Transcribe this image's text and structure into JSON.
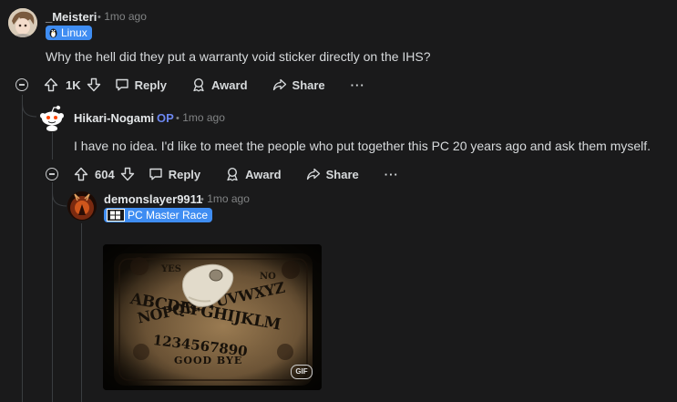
{
  "comments": [
    {
      "username": "_Meisteri",
      "time": "1mo ago",
      "flair": "Linux",
      "body": "Why the hell did they put a warranty void sticker directly on the IHS?",
      "votes": "1K"
    },
    {
      "username": "Hikari-Nogami",
      "op_badge": "OP",
      "time": "1mo ago",
      "body": "I have no idea. I'd like to meet the people who put together this PC 20 years ago and ask them myself.",
      "votes": "604"
    },
    {
      "username": "demonslayer9911",
      "time": "1mo ago",
      "flair": "PC Master Race",
      "media": {
        "badge": "GIF",
        "board_yes": "YES",
        "board_no": "NO",
        "board_row1": "ABCDEFGHIJKLM",
        "board_row2": "NOPQRSTUVWXYZ",
        "board_numbers": "1234567890",
        "board_goodbye": "GOOD BYE"
      }
    }
  ],
  "actions": {
    "reply": "Reply",
    "award": "Award",
    "share": "Share",
    "more": "···"
  },
  "separator": "•",
  "colors": {
    "background": "#1a1a1b",
    "flair": "#3f8df2",
    "op": "#6c87f0",
    "thread_line": "#3a3d40"
  }
}
